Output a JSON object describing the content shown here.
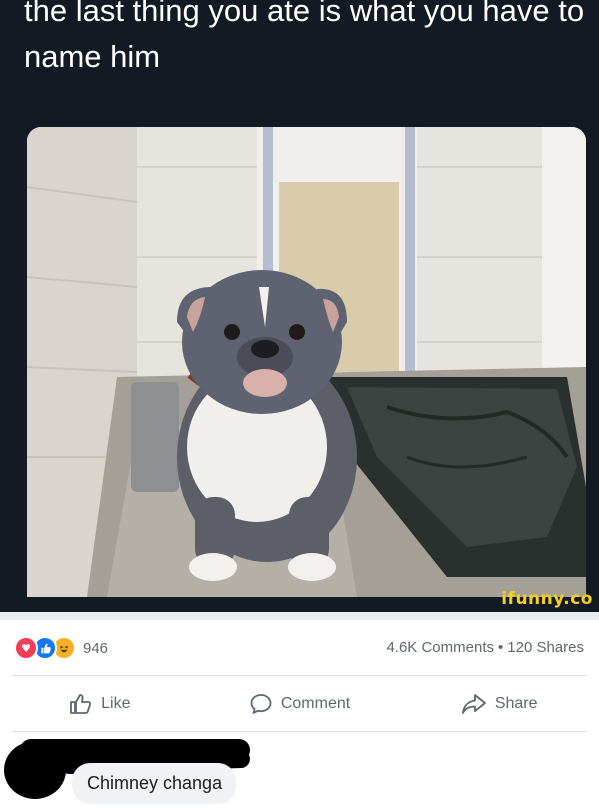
{
  "meme": {
    "caption": "the last thing you ate is what you have to name him",
    "watermark": "ifunny.co"
  },
  "post_stats": {
    "reactions": [
      "love-icon",
      "like-icon",
      "haha-icon"
    ],
    "reaction_count": "946",
    "comments": "4.6K Comments",
    "separator": "•",
    "shares": "120 Shares"
  },
  "actions": {
    "like_label": "Like",
    "comment_label": "Comment",
    "share_label": "Share"
  },
  "comment": {
    "text": "Chimney changa"
  },
  "colors": {
    "meme_background": "#141a24",
    "watermark": "#f5d11b",
    "love": "#f33e58",
    "like": "#1877f2",
    "haha": "#f7b125",
    "meta_text": "#606770"
  }
}
